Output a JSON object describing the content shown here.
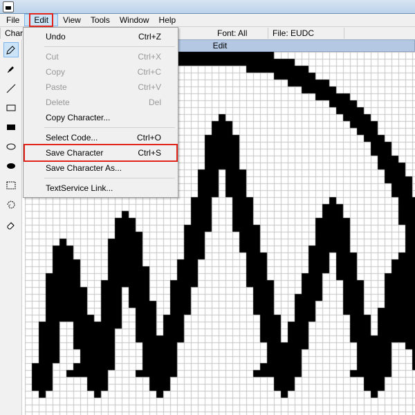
{
  "menubar": {
    "items": [
      "File",
      "Edit",
      "View",
      "Tools",
      "Window",
      "Help"
    ],
    "active": "Edit"
  },
  "infobar": {
    "label": "Charac",
    "font_label": "Font:",
    "font_value": "All",
    "file_label": "File:",
    "file_value": "EUDC"
  },
  "canvas_header": "Edit",
  "edit_menu": [
    {
      "label": "Undo",
      "shortcut": "Ctrl+Z",
      "disabled": false
    },
    {
      "sep": true
    },
    {
      "label": "Cut",
      "shortcut": "Ctrl+X",
      "disabled": true
    },
    {
      "label": "Copy",
      "shortcut": "Ctrl+C",
      "disabled": true
    },
    {
      "label": "Paste",
      "shortcut": "Ctrl+V",
      "disabled": true
    },
    {
      "label": "Delete",
      "shortcut": "Del",
      "disabled": true
    },
    {
      "label": "Copy Character...",
      "shortcut": "",
      "disabled": false
    },
    {
      "sep": true
    },
    {
      "label": "Select Code...",
      "shortcut": "Ctrl+O",
      "disabled": false
    },
    {
      "label": "Save Character",
      "shortcut": "Ctrl+S",
      "disabled": false,
      "highlight": true
    },
    {
      "label": "Save Character As...",
      "shortcut": "",
      "disabled": false
    },
    {
      "sep": true
    },
    {
      "label": "TextService Link...",
      "shortcut": "",
      "disabled": false
    }
  ],
  "tools": [
    {
      "name": "pencil",
      "selected": true
    },
    {
      "name": "brush",
      "selected": false
    },
    {
      "name": "line",
      "selected": false
    },
    {
      "name": "rect",
      "selected": false
    },
    {
      "name": "rect-filled",
      "selected": false
    },
    {
      "name": "ellipse",
      "selected": false
    },
    {
      "name": "ellipse-filled",
      "selected": false
    },
    {
      "name": "select-rect",
      "selected": false
    },
    {
      "name": "select-free",
      "selected": false
    },
    {
      "name": "eraser",
      "selected": false
    }
  ],
  "grid": {
    "cell": 10,
    "cols": 57,
    "rows": 53
  },
  "chart_data": null
}
